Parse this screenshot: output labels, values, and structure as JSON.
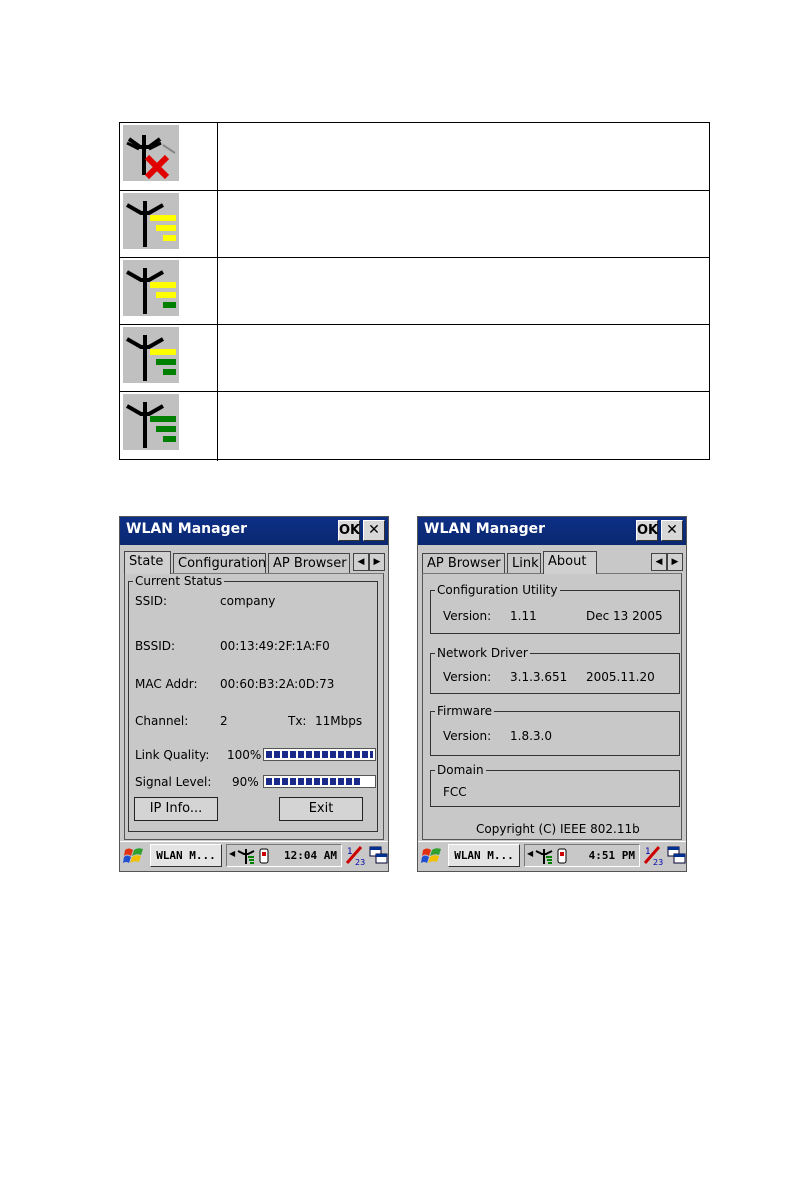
{
  "legend": {
    "rows": [
      {
        "icon": "signal-none-icon",
        "level": 0
      },
      {
        "icon": "signal-weak-icon",
        "level": 0
      },
      {
        "icon": "signal-fair-icon",
        "level": 1
      },
      {
        "icon": "signal-good-icon",
        "level": 2
      },
      {
        "icon": "signal-excellent-icon",
        "level": 3
      }
    ],
    "colors": {
      "bars_inactive": "#ffff00",
      "bars_active": "#008000",
      "cross": "#e00000",
      "tile": "#c0c0c0"
    }
  },
  "left_window": {
    "title": "WLAN Manager",
    "ok_label": "OK",
    "close_label": "✕",
    "tabs": [
      "State",
      "Configuration",
      "AP Browser"
    ],
    "active_tab": "State",
    "group_label": "Current Status",
    "ssid_label": "SSID:",
    "ssid_value": "company",
    "bssid_label": "BSSID:",
    "bssid_value": "00:13:49:2F:1A:F0",
    "mac_label": "MAC Addr:",
    "mac_value": "00:60:B3:2A:0D:73",
    "channel_label": "Channel:",
    "channel_value": "2",
    "tx_label": "Tx:",
    "tx_value": "11Mbps",
    "link_quality_label": "Link Quality:",
    "link_quality_value": "100%",
    "link_quality_fraction": 1.0,
    "signal_level_label": "Signal Level:",
    "signal_level_value": "90%",
    "signal_level_fraction": 0.9,
    "ip_info_button": "IP Info...",
    "exit_button": "Exit",
    "taskbar_item": "WLAN M...",
    "clock": "12:04 AM"
  },
  "right_window": {
    "title": "WLAN Manager",
    "ok_label": "OK",
    "close_label": "✕",
    "tabs": [
      "AP Browser",
      "Link",
      "About"
    ],
    "active_tab": "About",
    "config_group_label": "Configuration Utility",
    "config_version_label": "Version:",
    "config_version": "1.11",
    "config_date": "Dec 13 2005",
    "driver_group_label": "Network Driver",
    "driver_version_label": "Version:",
    "driver_version": "3.1.3.651",
    "driver_date": "2005.11.20",
    "firmware_group_label": "Firmware",
    "firmware_version_label": "Version:",
    "firmware_version": "1.8.3.0",
    "domain_group_label": "Domain",
    "domain_value": "FCC",
    "copyright": "Copyright (C)  IEEE  802.11b",
    "taskbar_item": "WLAN M...",
    "clock": "4:51 PM"
  },
  "colors": {
    "titlebar": "#0a2a7a",
    "progress": "#1a2a8a",
    "window_bg": "#c8c8c8"
  }
}
